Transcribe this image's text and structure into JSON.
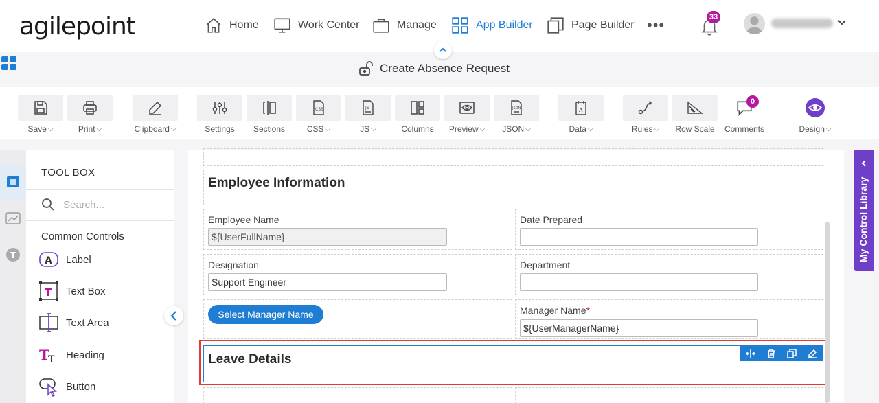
{
  "app": {
    "logo": "agilepoint"
  },
  "nav": {
    "items": [
      {
        "label": "Home",
        "icon": "home-icon"
      },
      {
        "label": "Work Center",
        "icon": "monitor-icon"
      },
      {
        "label": "Manage",
        "icon": "briefcase-icon"
      },
      {
        "label": "App Builder",
        "icon": "grid-icon",
        "active": true
      },
      {
        "label": "Page Builder",
        "icon": "pages-icon"
      }
    ],
    "more": "•••",
    "notifications_count": "33"
  },
  "form": {
    "title": "Create Absence Request"
  },
  "toolbar": {
    "items": [
      {
        "label": "Save",
        "dropdown": true
      },
      {
        "label": "Print",
        "dropdown": true
      },
      {
        "label": "Clipboard",
        "dropdown": true
      },
      {
        "label": "Settings",
        "dropdown": false
      },
      {
        "label": "Sections",
        "dropdown": false
      },
      {
        "label": "CSS",
        "dropdown": true
      },
      {
        "label": "JS",
        "dropdown": true
      },
      {
        "label": "Columns",
        "dropdown": false
      },
      {
        "label": "Preview",
        "dropdown": true
      },
      {
        "label": "JSON",
        "dropdown": true
      },
      {
        "label": "Data",
        "dropdown": true
      },
      {
        "label": "Rules",
        "dropdown": true
      },
      {
        "label": "Row Scale",
        "dropdown": false
      },
      {
        "label": "Comments",
        "dropdown": false
      },
      {
        "label": "Design",
        "dropdown": true
      }
    ],
    "comments_count": "0"
  },
  "toolbox": {
    "title": "TOOL BOX",
    "search_placeholder": "Search...",
    "section": "Common Controls",
    "tools": [
      "Label",
      "Text Box",
      "Text Area",
      "Heading",
      "Button"
    ]
  },
  "canvas": {
    "section1_heading": "Employee Information",
    "fields": {
      "employee_name_label": "Employee Name",
      "employee_name_value": "${UserFullName}",
      "date_prepared_label": "Date Prepared",
      "date_prepared_value": "",
      "designation_label": "Designation",
      "designation_value": "Support Engineer",
      "department_label": "Department",
      "department_value": "",
      "manager_name_label": "Manager Name",
      "manager_name_required": "*",
      "manager_name_value": "${UserManagerName}"
    },
    "select_manager_button": "Select Manager Name",
    "section2_heading": "Leave Details"
  },
  "right_panel": {
    "label": "My Control Library"
  },
  "colors": {
    "accent": "#1f7ed3",
    "badge": "#b5179e",
    "library_tab": "#6f3fc9",
    "selection": "#e53935"
  }
}
